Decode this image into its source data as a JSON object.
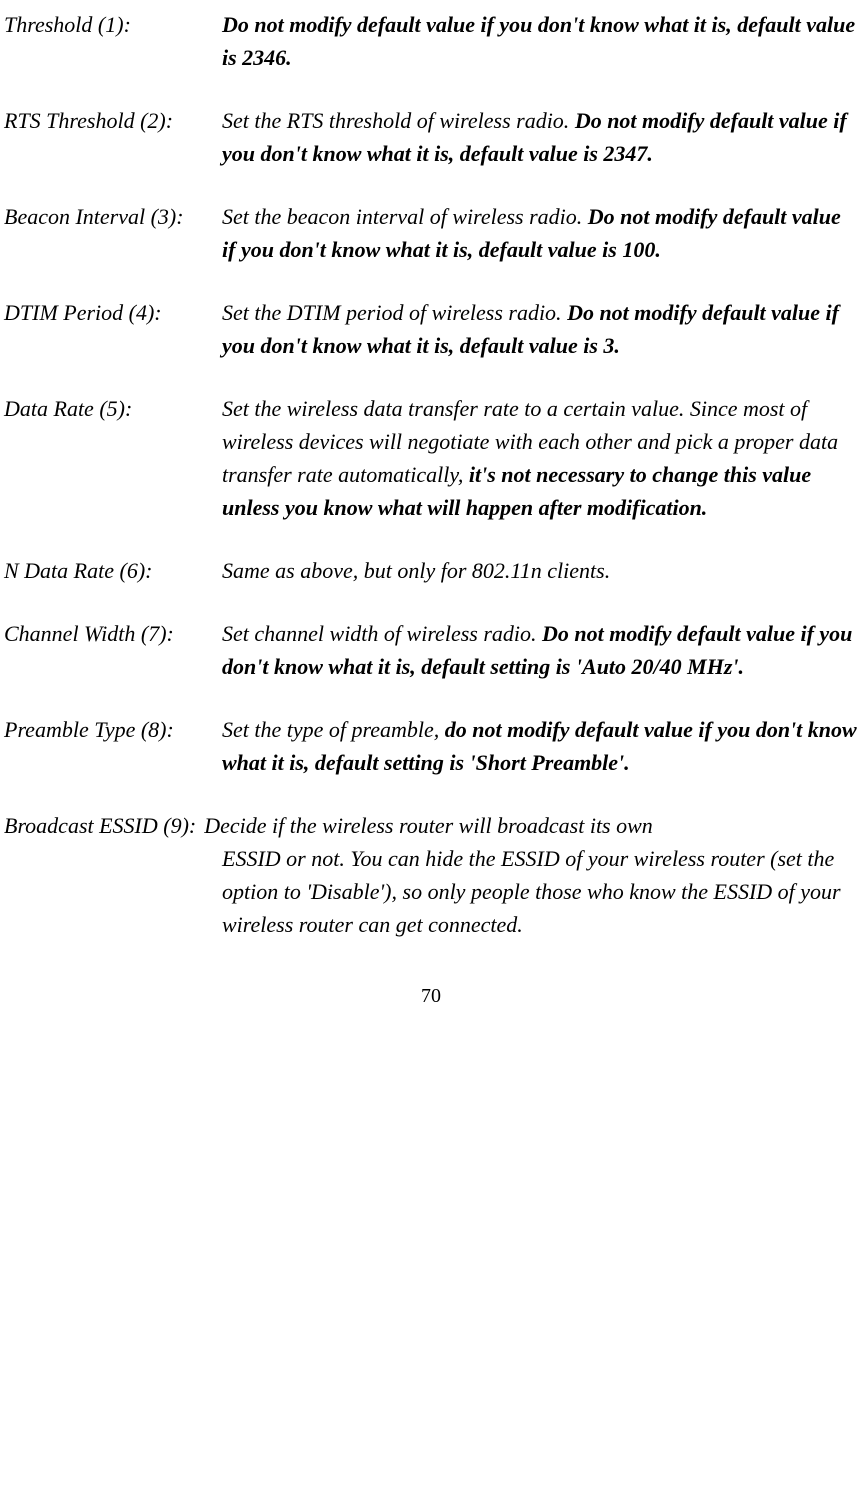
{
  "entries": [
    {
      "label": "Threshold (1):",
      "desc_bold": "Do not modify default value if you don't know what it is, default value is 2346."
    },
    {
      "label": "RTS Threshold (2):",
      "desc_plain": "Set the RTS threshold of wireless radio. ",
      "desc_bold": "Do not modify default value if you don't know what it is, default value is 2347."
    },
    {
      "label": "Beacon Interval (3):",
      "desc_plain": "Set the beacon interval of wireless radio. ",
      "desc_bold": "Do not modify default value if you don't know what it is, default value is 100."
    },
    {
      "label": "DTIM Period (4):",
      "desc_plain": "Set the DTIM period of wireless radio. ",
      "desc_bold": "Do not modify default value if you don't know what it is, default value is 3."
    },
    {
      "label": "Data Rate (5):",
      "desc_plain": "Set the wireless data transfer rate to a certain value. Since most of wireless devices will negotiate with each other and pick a proper data transfer rate automatically, ",
      "desc_bold": "it's not necessary to change this value unless you know what will happen after modification."
    },
    {
      "label": "N Data Rate (6):",
      "desc_plain": "Same as above, but only for 802.11n clients."
    },
    {
      "label": "Channel Width (7):",
      "desc_plain": "Set channel width of wireless radio. ",
      "desc_bold": "Do not modify default value if you don't know what it is, default setting is 'Auto 20/40 MHz'."
    },
    {
      "label": "Preamble Type (8):",
      "desc_plain": "Set the type of preamble, ",
      "desc_bold": "do not modify default value if you don't know what it is, default setting is 'Short Preamble'."
    },
    {
      "label": "Broadcast ESSID (9): ",
      "desc_plain_inline": "Decide if the wireless router will broadcast its own",
      "desc_plain_cont": "ESSID or not. You can hide the ESSID of your wireless router (set the option to 'Disable'), so only people those who know the ESSID of your wireless router can get connected."
    }
  ],
  "page_number": "70"
}
